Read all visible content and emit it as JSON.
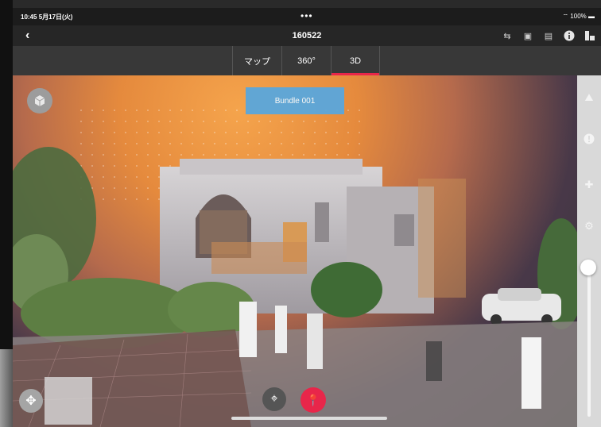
{
  "status": {
    "time": "10:45",
    "date": "5月17日(火)",
    "battery": "100%"
  },
  "nav": {
    "back": "‹",
    "title": "160522"
  },
  "tabs": [
    {
      "label": "マップ"
    },
    {
      "label": "360°"
    },
    {
      "label": "3D",
      "active": true
    }
  ],
  "viewer": {
    "bundle_label": "Bundle 001"
  },
  "colors": {
    "accent": "#e8264a",
    "bundle": "#5aa7dc"
  },
  "icons": {
    "nav_right": [
      "swap-icon",
      "camera-icon",
      "document-icon",
      "info-icon",
      "layout-icon"
    ],
    "sidebar": [
      "layers-icon",
      "alert-icon",
      "pin-icon",
      "gear-icon"
    ]
  }
}
